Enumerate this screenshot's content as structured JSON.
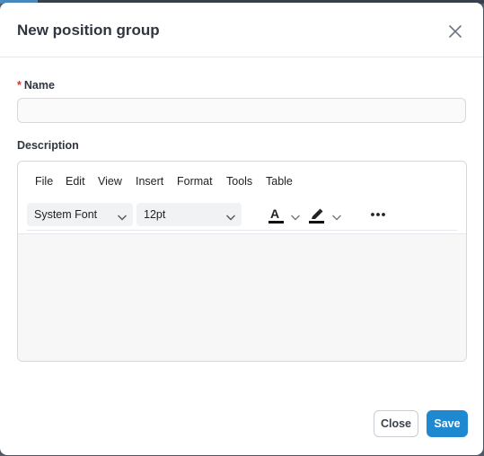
{
  "dialog": {
    "title": "New position group",
    "close_icon": "close-icon"
  },
  "name_field": {
    "required_mark": "*",
    "label": "Name",
    "value": "",
    "placeholder": ""
  },
  "description_field": {
    "label": "Description"
  },
  "editor": {
    "menu": [
      "File",
      "Edit",
      "View",
      "Insert",
      "Format",
      "Tools",
      "Table"
    ],
    "font_family": "System Font",
    "font_size": "12pt",
    "text_color_letter": "A",
    "icons": {
      "text_color": "text-color-icon",
      "highlight": "highlight-marker-icon",
      "more": "more-horizontal-icon",
      "dropdown": "chevron-down-icon"
    },
    "content": ""
  },
  "footer": {
    "close_label": "Close",
    "save_label": "Save"
  },
  "colors": {
    "accent": "#1e88d0",
    "required": "#d9342b",
    "text": "#2f3640"
  }
}
